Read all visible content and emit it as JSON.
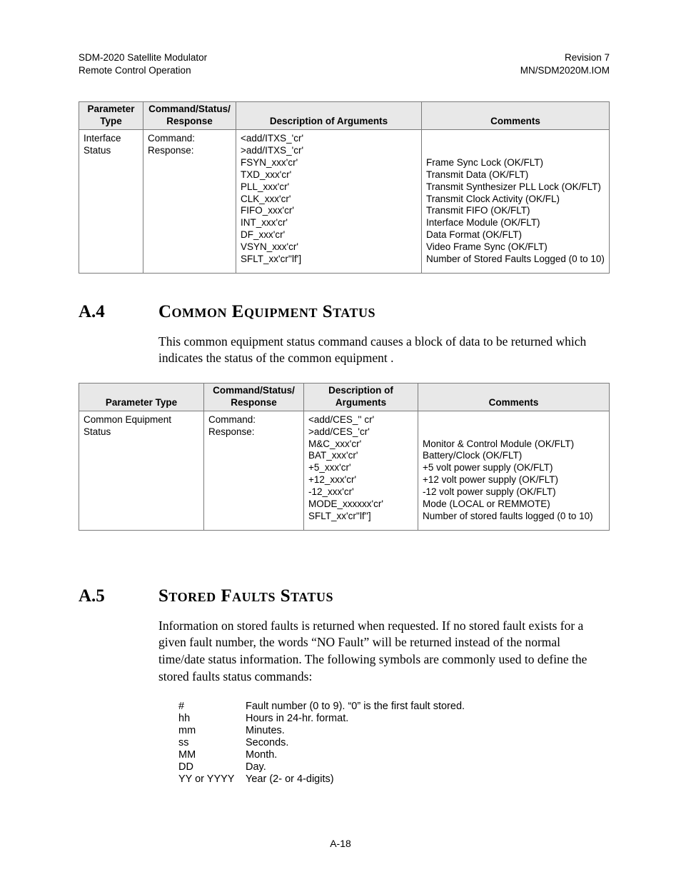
{
  "header": {
    "left_line1": "SDM-2020 Satellite Modulator",
    "left_line2": "Remote Control Operation",
    "right_line1": "Revision 7",
    "right_line2": "MN/SDM2020M.IOM"
  },
  "table1": {
    "headers": {
      "c1a": "Parameter",
      "c1b": "Type",
      "c2a": "Command/Status/",
      "c2b": "Response",
      "c3": "Description of Arguments",
      "c4": "Comments"
    },
    "row": {
      "param": "Interface\nStatus",
      "csr": "Command:\nResponse:",
      "args": "<add/ITXS_'cr'\n>add/ITXS_'cr'\nFSYN_xxx'cr'\nTXD_xxx'cr'\nPLL_xxx'cr'\nCLK_xxx'cr'\nFIFO_xxx'cr'\nINT_xxx'cr'\nDF_xxx'cr'\nVSYN_xxx'cr'\nSFLT_xx'cr''lf']",
      "comments": "\n\nFrame Sync Lock (OK/FLT)\nTransmit Data (OK/FLT)\nTransmit Synthesizer PLL Lock (OK/FLT)\nTransmit Clock Activity (OK/FL)\nTransmit FIFO (OK/FLT)\nInterface Module (OK/FLT)\nData Format (OK/FLT)\nVideo Frame Sync (OK/FLT)\nNumber of Stored Faults Logged (0 to 10)"
    }
  },
  "sectionA4": {
    "num": "A.4",
    "title": "Common Equipment Status",
    "para": "This common equipment status command causes a block of data to be returned which indicates the status of the common equipment ."
  },
  "table2": {
    "headers": {
      "c1": "Parameter Type",
      "c2a": "Command/Status/",
      "c2b": "Response",
      "c3a": "Description of",
      "c3b": "Arguments",
      "c4": "Comments"
    },
    "row": {
      "param": "Common Equipment\nStatus",
      "csr": "Command:\nResponse:",
      "args": "<add/CES_'' cr'\n>add/CES_'cr'\nM&C_xxx'cr'\nBAT_xxx'cr'\n+5_xxx'cr'\n+12_xxx'cr'\n-12_xxx'cr'\nMODE_xxxxxx'cr'\nSFLT_xx'cr''lf'']",
      "comments": "\n\nMonitor & Control Module (OK/FLT)\nBattery/Clock (OK/FLT)\n+5 volt power supply (OK/FLT)\n+12 volt power supply (OK/FLT)\n-12 volt power supply (OK/FLT)\nMode (LOCAL or REMMOTE)\nNumber of stored faults logged (0 to 10)"
    }
  },
  "sectionA5": {
    "num": "A.5",
    "title": "Stored Faults Status",
    "para": "Information on stored faults is returned when requested. If no stored fault exists for a given fault number, the words “NO Fault” will be returned instead of the normal time/date status information. The following symbols are commonly used to define the stored faults status commands:"
  },
  "symbols": [
    {
      "k": "#",
      "v": "Fault number (0 to 9). “0” is the first fault stored."
    },
    {
      "k": "hh",
      "v": "Hours in 24-hr. format."
    },
    {
      "k": "mm",
      "v": "Minutes."
    },
    {
      "k": "ss",
      "v": "Seconds."
    },
    {
      "k": "MM",
      "v": "Month."
    },
    {
      "k": "DD",
      "v": "Day."
    },
    {
      "k": "YY or YYYY",
      "v": "Year (2- or 4-digits)"
    }
  ],
  "footer": "A-18"
}
